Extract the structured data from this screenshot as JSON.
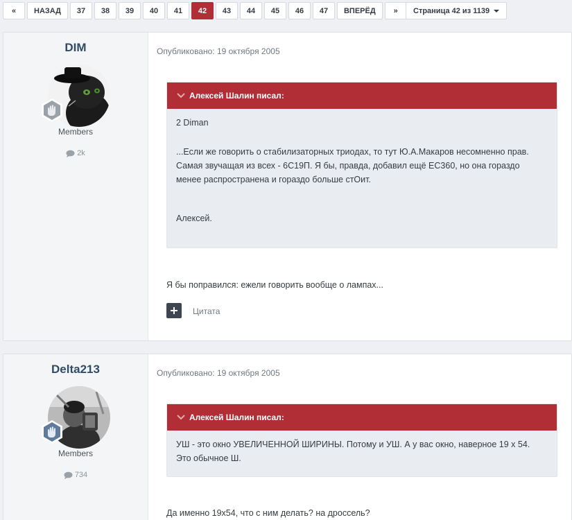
{
  "pagination": {
    "first_label": "«",
    "prev_label": "НАЗАД",
    "pages": [
      "37",
      "38",
      "39",
      "40",
      "41",
      "42",
      "43",
      "44",
      "45",
      "46",
      "47"
    ],
    "current_page": "42",
    "next_label": "ВПЕРЁД",
    "last_label": "»",
    "jump_label": "Страница 42 из 1139"
  },
  "posts": [
    {
      "author": "DIM",
      "group": "Members",
      "post_count": "2k",
      "date": "Опубликовано: 19 октября 2005",
      "id": "id: 12445",
      "quote": {
        "header": "Алексей Шалин писал:",
        "lines": [
          "2 Diman",
          "...Если же говорить о стабилизаторных триодах, то тут Ю.А.Макаров несомненно прав.",
          "Самая звучащая из всех - 6С19П. Я бы, правда, добавил ещё ЕС360, но она гораздо",
          "менее распространена и гораздо больше стОит.",
          "Алексей."
        ]
      },
      "text": "Я бы поправился: ежели говорить вообще о лампах...",
      "quote_button": "Цитата"
    },
    {
      "author": "Delta213",
      "group": "Members",
      "post_count": "734",
      "date": "Опубликовано: 19 октября 2005",
      "id": "id: 12446",
      "quote": {
        "header": "Алексей Шалин писал:",
        "lines": [
          "УШ - это окно УВЕЛИЧЕННОЙ ШИРИНЫ. Потому и УШ. А у вас окно, наверное 19 х 54.",
          "Это обычное Ш."
        ]
      },
      "text": "Да именно 19х54, что с ним делать? на дроссель?"
    }
  ],
  "icons": {
    "share": "share-icon",
    "comment": "comment-icon",
    "rank": "rank-badge-icon",
    "quote_toggle": "chevron-down-icon",
    "multiquote": "plus-icon"
  },
  "colors": {
    "accent": "#b12e36",
    "author_name": "#2f4b68",
    "quote_bg": "#e9ecf1"
  }
}
